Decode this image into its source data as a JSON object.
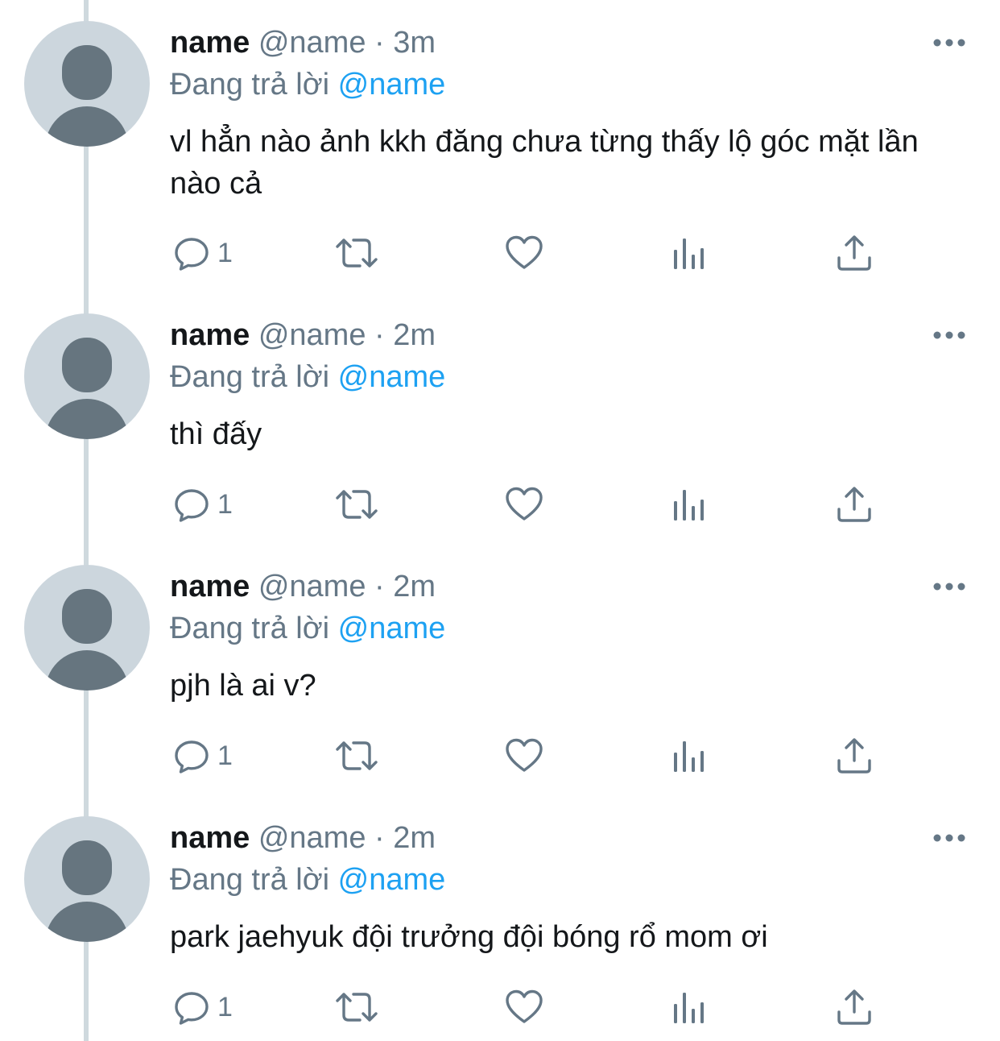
{
  "tweets": [
    {
      "author": "name",
      "handle": "@name",
      "separator": "·",
      "time": "3m",
      "reply_prefix": "Đang trả lời",
      "reply_to": "@name",
      "text": "vl hẳn nào ảnh kkh đăng chưa từng thấy lộ góc mặt lần nào cả",
      "reply_count": "1"
    },
    {
      "author": "name",
      "handle": "@name",
      "separator": "·",
      "time": "2m",
      "reply_prefix": "Đang trả lời",
      "reply_to": "@name",
      "text": "thì đấy",
      "reply_count": "1"
    },
    {
      "author": "name",
      "handle": "@name",
      "separator": "·",
      "time": "2m",
      "reply_prefix": "Đang trả lời",
      "reply_to": "@name",
      "text": "pjh là ai v?",
      "reply_count": "1"
    },
    {
      "author": "name",
      "handle": "@name",
      "separator": "·",
      "time": "2m",
      "reply_prefix": "Đang trả lời",
      "reply_to": "@name",
      "text": "park jaehyuk đội trưởng đội bóng rổ mom ơi",
      "reply_count": "1"
    }
  ],
  "icons": {
    "reply": "reply-bubble-icon",
    "retweet": "retweet-icon",
    "like": "heart-icon",
    "analytics": "analytics-bars-icon",
    "share": "share-upload-icon",
    "more": "more-dots-icon"
  },
  "colors": {
    "text_primary": "#14171a",
    "text_secondary": "#657786",
    "link": "#1da1f2",
    "avatar_bg": "#ccd6dd",
    "avatar_fg": "#66757f",
    "thread_line": "#cfd9de"
  }
}
